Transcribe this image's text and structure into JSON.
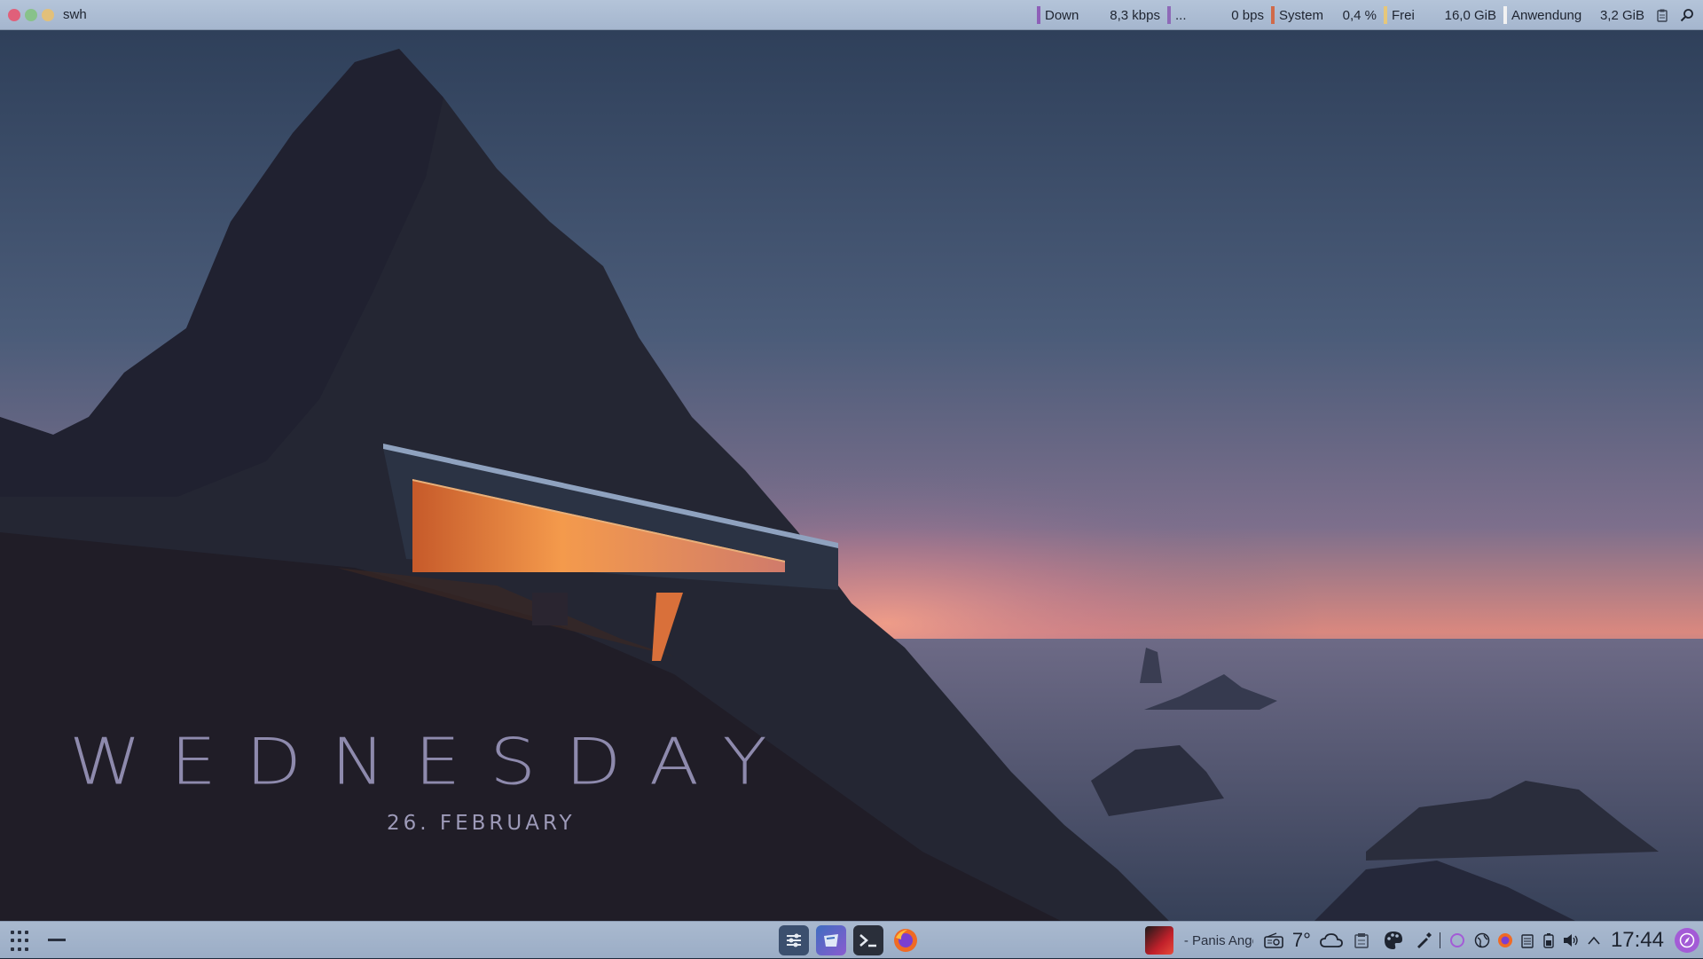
{
  "window": {
    "title": "swh"
  },
  "system_monitor": [
    {
      "label": "Down",
      "value": "8,3 kbps",
      "color": "#8e5fb8"
    },
    {
      "label": "...",
      "value": "0 bps",
      "color": "#8e6ab8"
    },
    {
      "label": "System",
      "value": "0,4 %",
      "color": "#d06a4a"
    },
    {
      "label": "Frei",
      "value": "16,0 GiB",
      "color": "#e6c77a"
    },
    {
      "label": "Anwendung",
      "value": "3,2 GiB",
      "color": "#f2f2f2"
    }
  ],
  "top_icons": {
    "clipboard": "clipboard-icon",
    "search": "search-icon"
  },
  "wallpaper": {
    "day": "WEDNESDAY",
    "date": "26. FEBRUARY"
  },
  "taskbar": {
    "apps": [
      {
        "name": "system-settings-icon",
        "color": "#3b4f6e"
      },
      {
        "name": "discover-icon",
        "color": "#4a6fb0"
      },
      {
        "name": "terminal-icon",
        "color": "#2a2f3a"
      },
      {
        "name": "firefox-icon",
        "color": "#f06a24"
      }
    ]
  },
  "tray": {
    "media_title": "- Panis Angelicus",
    "temperature": "7°",
    "clock": "17:44"
  },
  "colors": {
    "panel": "#a9b9cf",
    "accent": "#a35bd6"
  }
}
